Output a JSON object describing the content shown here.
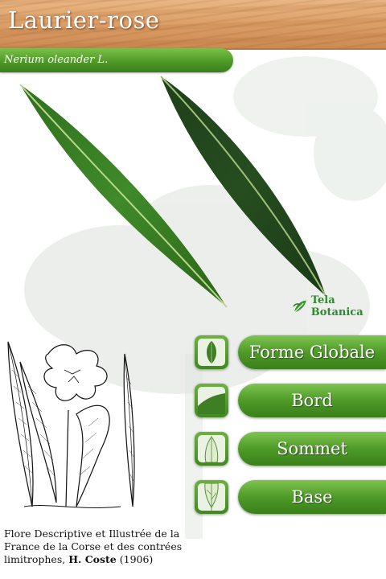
{
  "header": {
    "title": "Laurier-rose"
  },
  "subtitle": {
    "scientific_name": "Nerium oleander L."
  },
  "logo": {
    "text": "Tela Botanica"
  },
  "menu": {
    "items": [
      {
        "label": "Forme Globale",
        "icon": "leaf-shape-icon"
      },
      {
        "label": "Bord",
        "icon": "leaf-edge-icon"
      },
      {
        "label": "Sommet",
        "icon": "leaf-tip-icon"
      },
      {
        "label": "Base",
        "icon": "leaf-base-icon"
      }
    ]
  },
  "caption": {
    "line1": "Flore Descriptive et Illustrée de la",
    "line2": "France de la Corse et des contrées",
    "line3_prefix": "limitrophes, ",
    "author": "H. Coste",
    "year": " (1906)"
  },
  "colors": {
    "accent_green": "#4f9a28",
    "header_wood": "#d99a62"
  }
}
